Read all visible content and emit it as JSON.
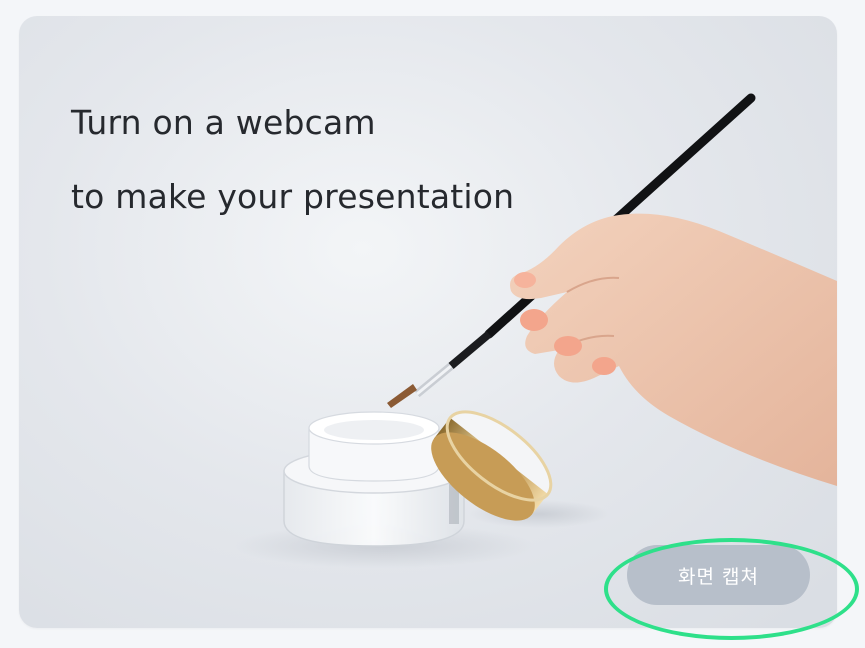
{
  "headline": {
    "line1": "Turn on a webcam",
    "line2": "to make your presentation"
  },
  "capture_button": {
    "label": "화면 캡쳐"
  },
  "colors": {
    "button_bg": "#b7bfca",
    "highlight_ring": "#2ee08a"
  }
}
